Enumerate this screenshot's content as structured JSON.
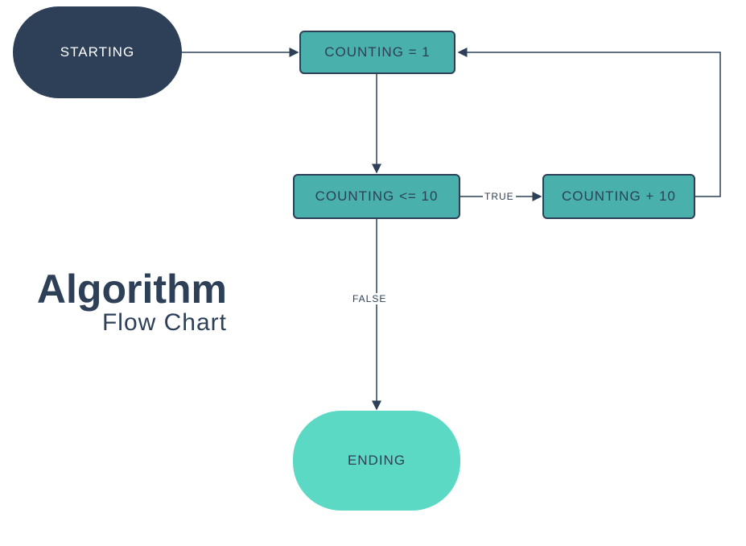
{
  "title": {
    "main": "Algorithm",
    "sub": "Flow Chart"
  },
  "nodes": {
    "starting": "STARTING",
    "counting_init": "COUNTING = 1",
    "counting_cond": "COUNTING <= 10",
    "counting_inc": "COUNTING + 10",
    "ending": "ENDING"
  },
  "edges": {
    "true_label": "TRUE",
    "false_label": "FALSE"
  },
  "colors": {
    "dark": "#2d4057",
    "teal": "#49b0ac",
    "mint": "#5bd9c4"
  }
}
